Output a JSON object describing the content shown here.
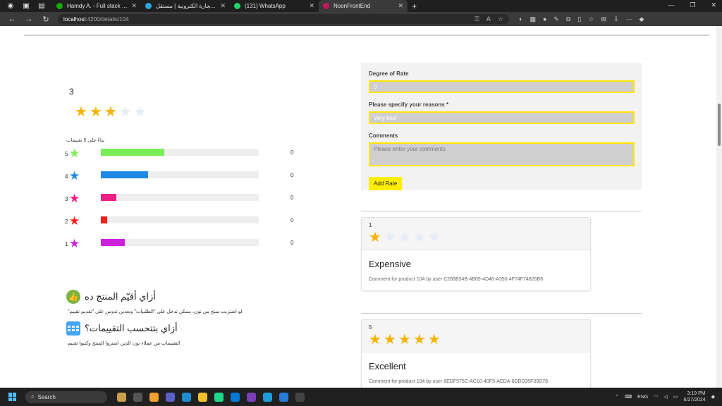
{
  "browser": {
    "tabs": [
      {
        "title": "Hamdy A. - Full stack web develo",
        "favicon_color": "#14a800",
        "active": false
      },
      {
        "title": "نون لتجارة الكترونية | مستقل",
        "favicon_color": "#2aa8e0",
        "active": false
      },
      {
        "title": "(131) WhatsApp",
        "favicon_color": "#25d366",
        "active": false
      },
      {
        "title": "NoonFrontEnd",
        "favicon_color": "#c2185b",
        "active": true
      }
    ],
    "new_tab_icon": "+",
    "url_host": "localhost",
    "url_path": ":4200/details/104"
  },
  "rating_summary": {
    "average": "3",
    "average_stars": 3,
    "max_stars": 5,
    "based_on": "بناءً على 5 تقييمات",
    "rows": [
      {
        "stars": "5",
        "count": "0",
        "color": "#77ee55",
        "fill_fraction": 0.4
      },
      {
        "stars": "4",
        "count": "0",
        "color": "#1e88e5",
        "fill_fraction": 0.3
      },
      {
        "stars": "3",
        "count": "0",
        "color": "#ec1f83",
        "fill_fraction": 0.1
      },
      {
        "stars": "2",
        "count": "0",
        "color": "#ff1a1a",
        "fill_fraction": 0.04
      },
      {
        "stars": "1",
        "count": "0",
        "color": "#cc22dd",
        "fill_fraction": 0.15
      }
    ]
  },
  "help": {
    "how_rate_title": "أزاي أقيّم المنتج ده",
    "how_rate_text": "\"لو اشتريت منتج من نون، ممكن تدخل على \"الطلبيات\" وبعدين تدوس على \"تقديم تقييم",
    "how_calc_title": "أزاي بتتحسب التقييمات؟",
    "how_calc_text": "التقييمات من عملاء نون الذين اشتروا المنتج وكتبوا تقييم"
  },
  "form": {
    "degree_label": "Degree of Rate",
    "degree_value": "0",
    "reasons_label": "Please specify your reasons *",
    "reasons_value": "Very bad",
    "comments_label": "Comments",
    "comments_placeholder": "Please enter your comments",
    "add_button": "Add Rate"
  },
  "reviews": [
    {
      "rating_text": "1",
      "rating": 1,
      "title": "Expensive",
      "comment": "Comment for product 104 by user C266B34B-4B09-4D46-A350-4F74F74826B6"
    },
    {
      "rating_text": "5",
      "rating": 5,
      "title": "Excellent",
      "comment": "Comment for product 104 by user 8EDF575C-AC10-40F5-AEDA-6DBD35F39D78"
    }
  ],
  "colors": {
    "star_on": "#f5b301",
    "star_off": "#e5ecf6",
    "accent_yellow": "#ffee00"
  },
  "taskbar": {
    "search_label": "Search",
    "language": "ENG",
    "time": "3:19 PM",
    "date": "6/27/2024"
  }
}
